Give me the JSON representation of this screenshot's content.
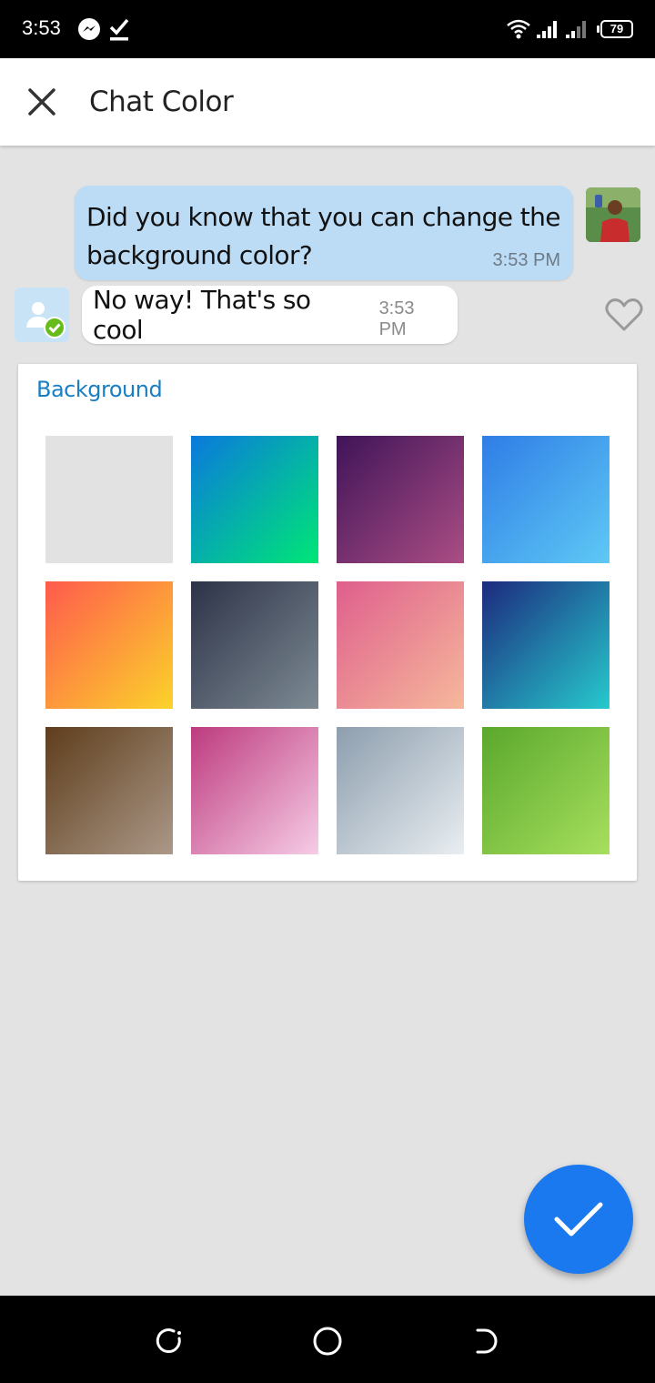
{
  "status_bar": {
    "time": "3:53",
    "battery": "79",
    "icons": [
      "messenger-icon",
      "check-download-icon",
      "wifi-icon",
      "signal-icon",
      "signal-icon",
      "battery-icon"
    ]
  },
  "app_bar": {
    "close_icon": "close-icon",
    "title": "Chat Color"
  },
  "preview": {
    "outgoing": {
      "text": "Did you know that you can change the background color?",
      "time": "3:53 PM"
    },
    "incoming": {
      "text": "No way! That's so cool",
      "time": "3:53 PM"
    },
    "like_icon": "heart-outline-icon"
  },
  "background_card": {
    "title": "Background",
    "swatches": [
      {
        "name": "light-gray",
        "from": "#e2e2e2",
        "to": "#e2e2e2"
      },
      {
        "name": "blue-green",
        "from": "#0a79dd",
        "to": "#00e676"
      },
      {
        "name": "purple",
        "from": "#3f1458",
        "to": "#ab4d84"
      },
      {
        "name": "sky-blue",
        "from": "#2f7de6",
        "to": "#5ec9f5"
      },
      {
        "name": "orange",
        "from": "#ff5a4d",
        "to": "#fbd32a"
      },
      {
        "name": "slate",
        "from": "#2d3348",
        "to": "#7d8a93"
      },
      {
        "name": "pink",
        "from": "#df5f8d",
        "to": "#f6b89b"
      },
      {
        "name": "navy-teal",
        "from": "#1c2a7e",
        "to": "#26cacd"
      },
      {
        "name": "brown",
        "from": "#5e3d1b",
        "to": "#ab9888"
      },
      {
        "name": "magenta",
        "from": "#bd3b7e",
        "to": "#f6cce6"
      },
      {
        "name": "silver",
        "from": "#8d9eae",
        "to": "#e9eef1"
      },
      {
        "name": "green",
        "from": "#5aa82d",
        "to": "#a7df5d"
      }
    ]
  },
  "fab": {
    "icon": "check-icon",
    "color": "#1b79f0"
  },
  "nav_bar": {
    "icons": [
      "recents-icon",
      "home-icon",
      "back-icon"
    ]
  }
}
